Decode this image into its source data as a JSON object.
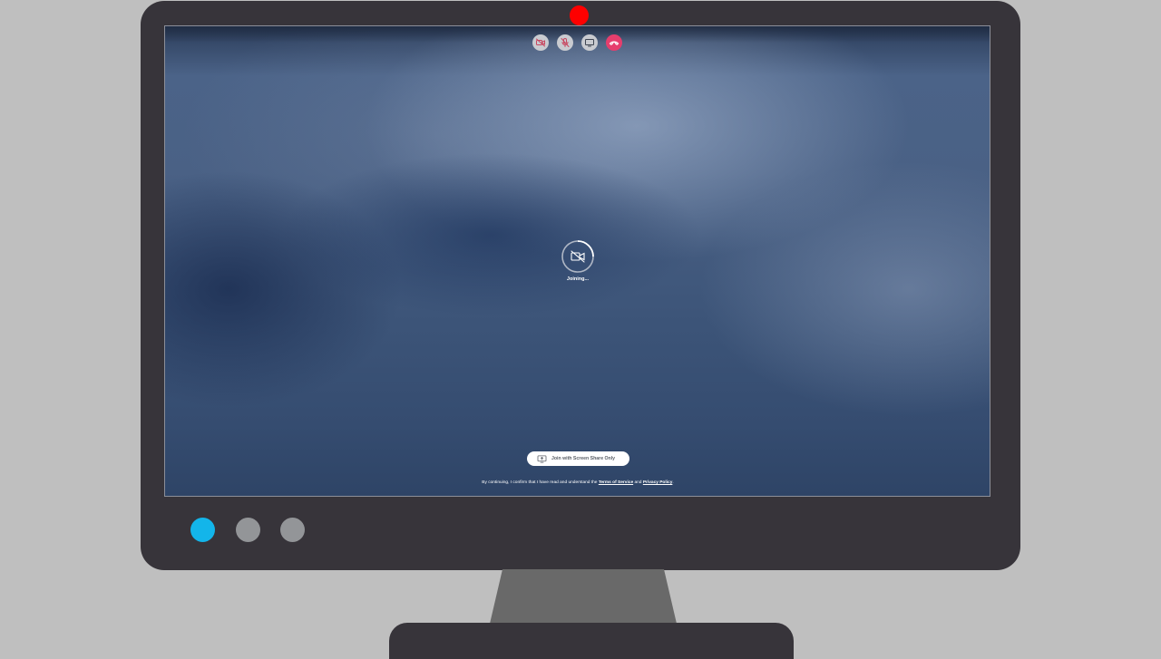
{
  "top_controls": [
    {
      "name": "camera-off-icon"
    },
    {
      "name": "mic-off-icon"
    },
    {
      "name": "screen-share-icon"
    },
    {
      "name": "hang-up-icon"
    }
  ],
  "status": {
    "label": "Joining...",
    "icon": "camera-off-icon"
  },
  "share_button": {
    "label": "Join with Screen Share Only",
    "icon": "screen-share-icon"
  },
  "consent": {
    "prefix": "By continuing, I confirm that I have read and understand the",
    "terms_link": "Terms of Service",
    "conjunction": "and",
    "privacy_link": "Privacy Policy",
    "suffix": "."
  },
  "monitor_buttons": [
    {
      "name": "power-button",
      "color": "#13b5ea"
    },
    {
      "name": "menu-button",
      "color": "#939598"
    },
    {
      "name": "settings-button",
      "color": "#939598"
    }
  ],
  "colors": {
    "monitor_frame": "#37343a",
    "camera_indicator": "#fe0000",
    "hang_up": "#e63e6d",
    "desk_background": "#bfbfbf",
    "stand": "#696969"
  }
}
